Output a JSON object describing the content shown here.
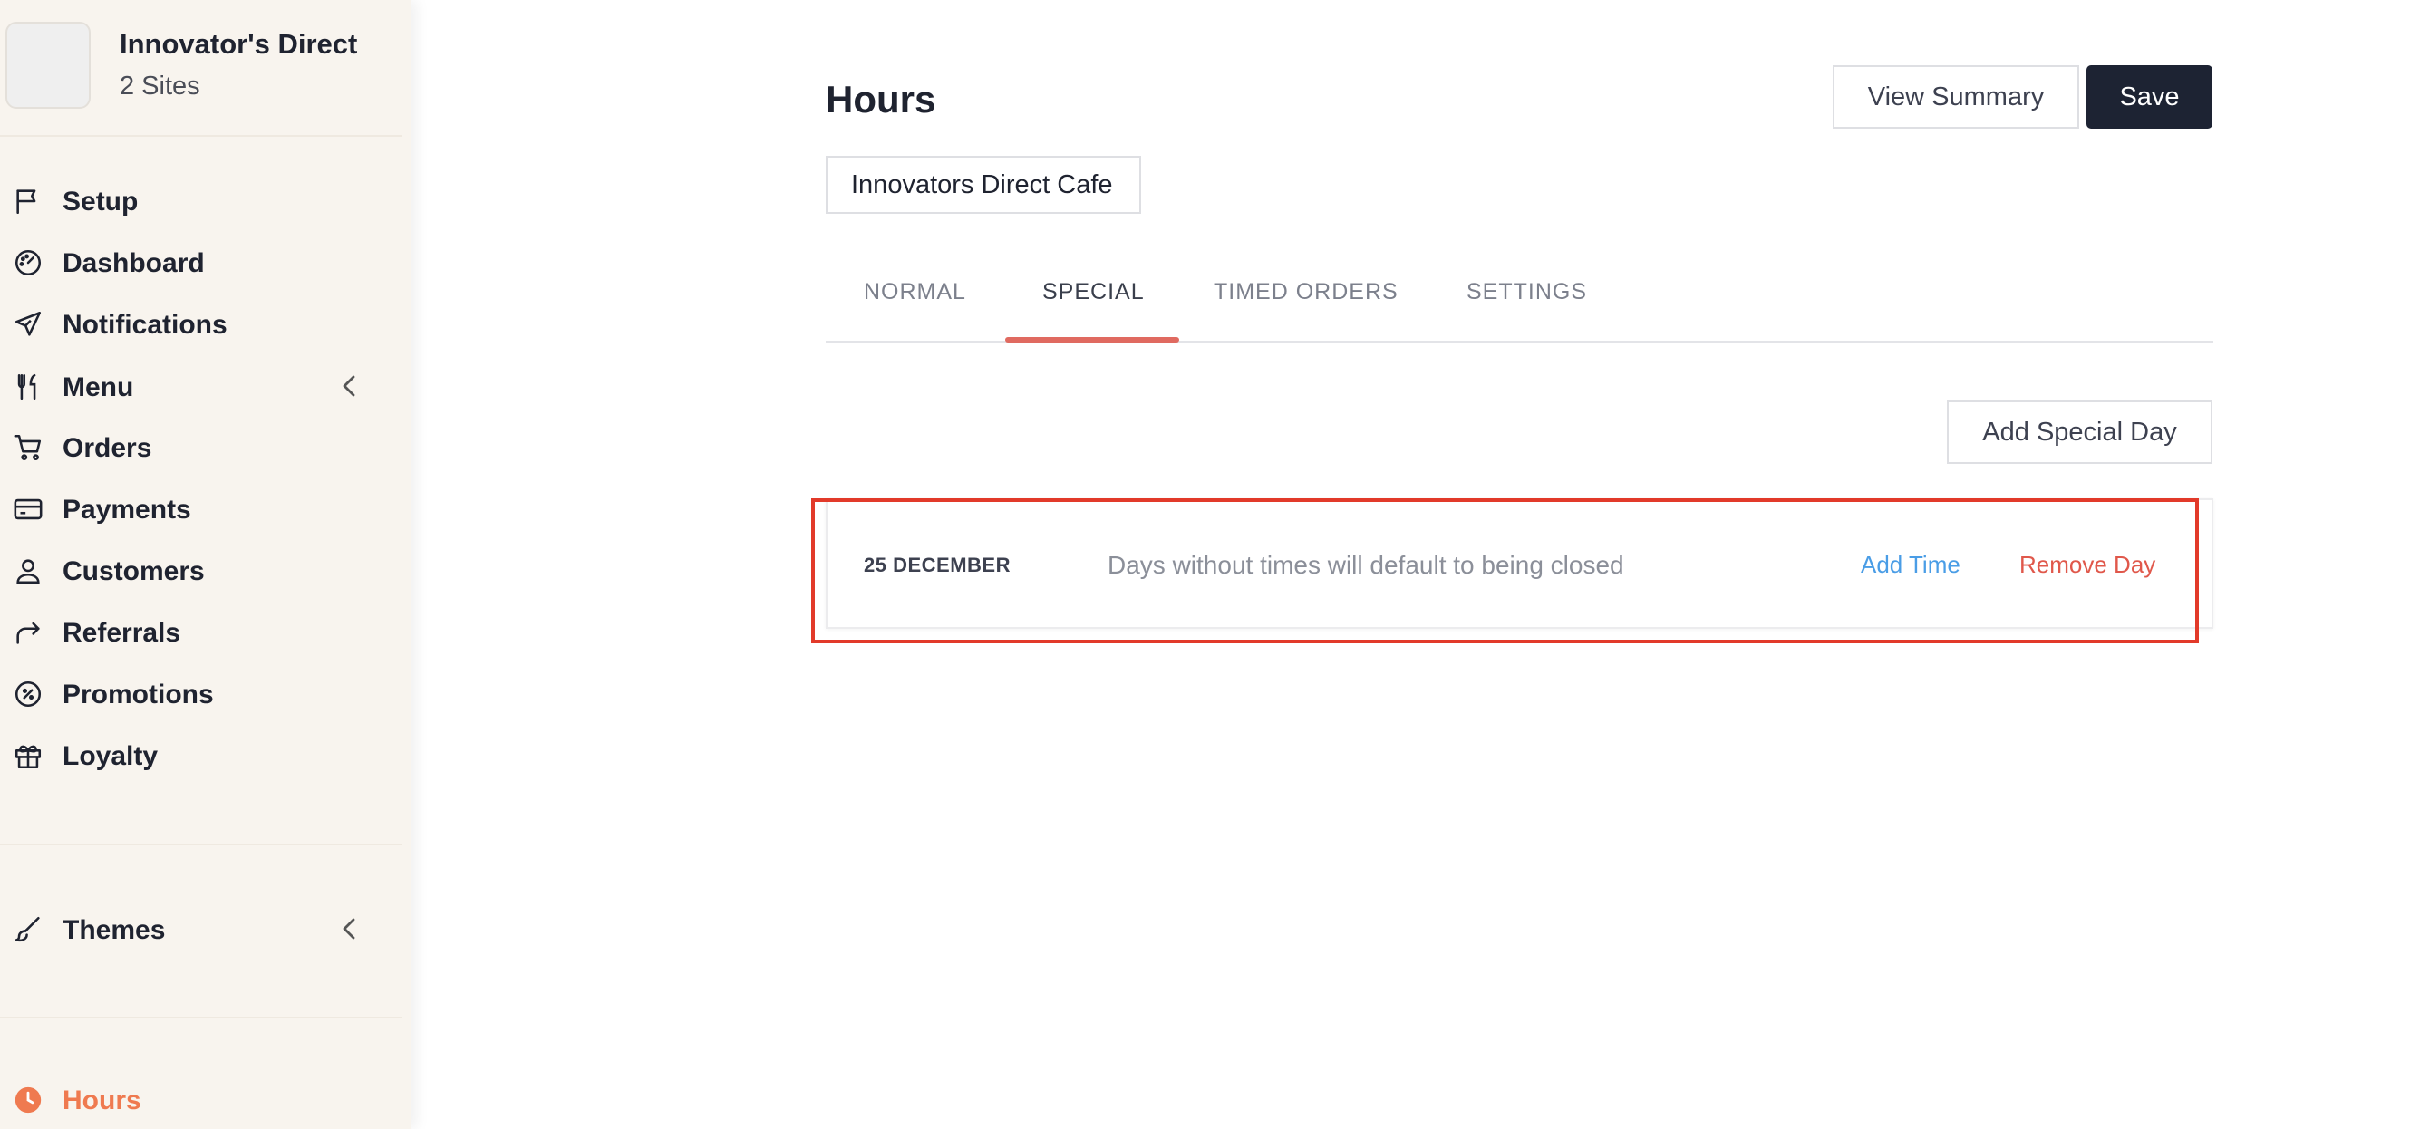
{
  "brand": {
    "name": "Innovator's Direct",
    "sites": "2 Sites"
  },
  "sidebar": {
    "items": [
      {
        "label": "Setup",
        "icon": "flag-icon"
      },
      {
        "label": "Dashboard",
        "icon": "gauge-icon"
      },
      {
        "label": "Notifications",
        "icon": "send-icon"
      },
      {
        "label": "Menu",
        "icon": "utensils-icon",
        "has_chevron": true
      },
      {
        "label": "Orders",
        "icon": "cart-icon"
      },
      {
        "label": "Payments",
        "icon": "credit-card-icon"
      },
      {
        "label": "Customers",
        "icon": "user-icon"
      },
      {
        "label": "Referrals",
        "icon": "share-arrow-icon"
      },
      {
        "label": "Promotions",
        "icon": "discount-badge-icon"
      },
      {
        "label": "Loyalty",
        "icon": "gift-icon"
      },
      {
        "label": "Themes",
        "icon": "brush-icon",
        "has_chevron": true
      },
      {
        "label": "Hours",
        "icon": "clock-icon",
        "active": true
      }
    ]
  },
  "main": {
    "title": "Hours",
    "view_summary_label": "View Summary",
    "save_label": "Save",
    "site_select_value": "Innovators Direct Cafe",
    "tabs": [
      {
        "label": "NORMAL"
      },
      {
        "label": "SPECIAL",
        "active": true
      },
      {
        "label": "TIMED ORDERS"
      },
      {
        "label": "SETTINGS"
      }
    ],
    "add_special_day_label": "Add Special Day",
    "special_days": [
      {
        "date": "25 DECEMBER",
        "note": "Days without times will default to being closed",
        "add_time_label": "Add Time",
        "remove_day_label": "Remove Day"
      }
    ]
  },
  "colors": {
    "accent_orange": "#ef7a50",
    "tab_underline": "#e06a60",
    "highlight_red": "#e23a2a",
    "link_blue": "#4a9de6",
    "link_red": "#e0584b",
    "dark_button": "#1d2333",
    "sidebar_bg": "#f8f4ee"
  }
}
